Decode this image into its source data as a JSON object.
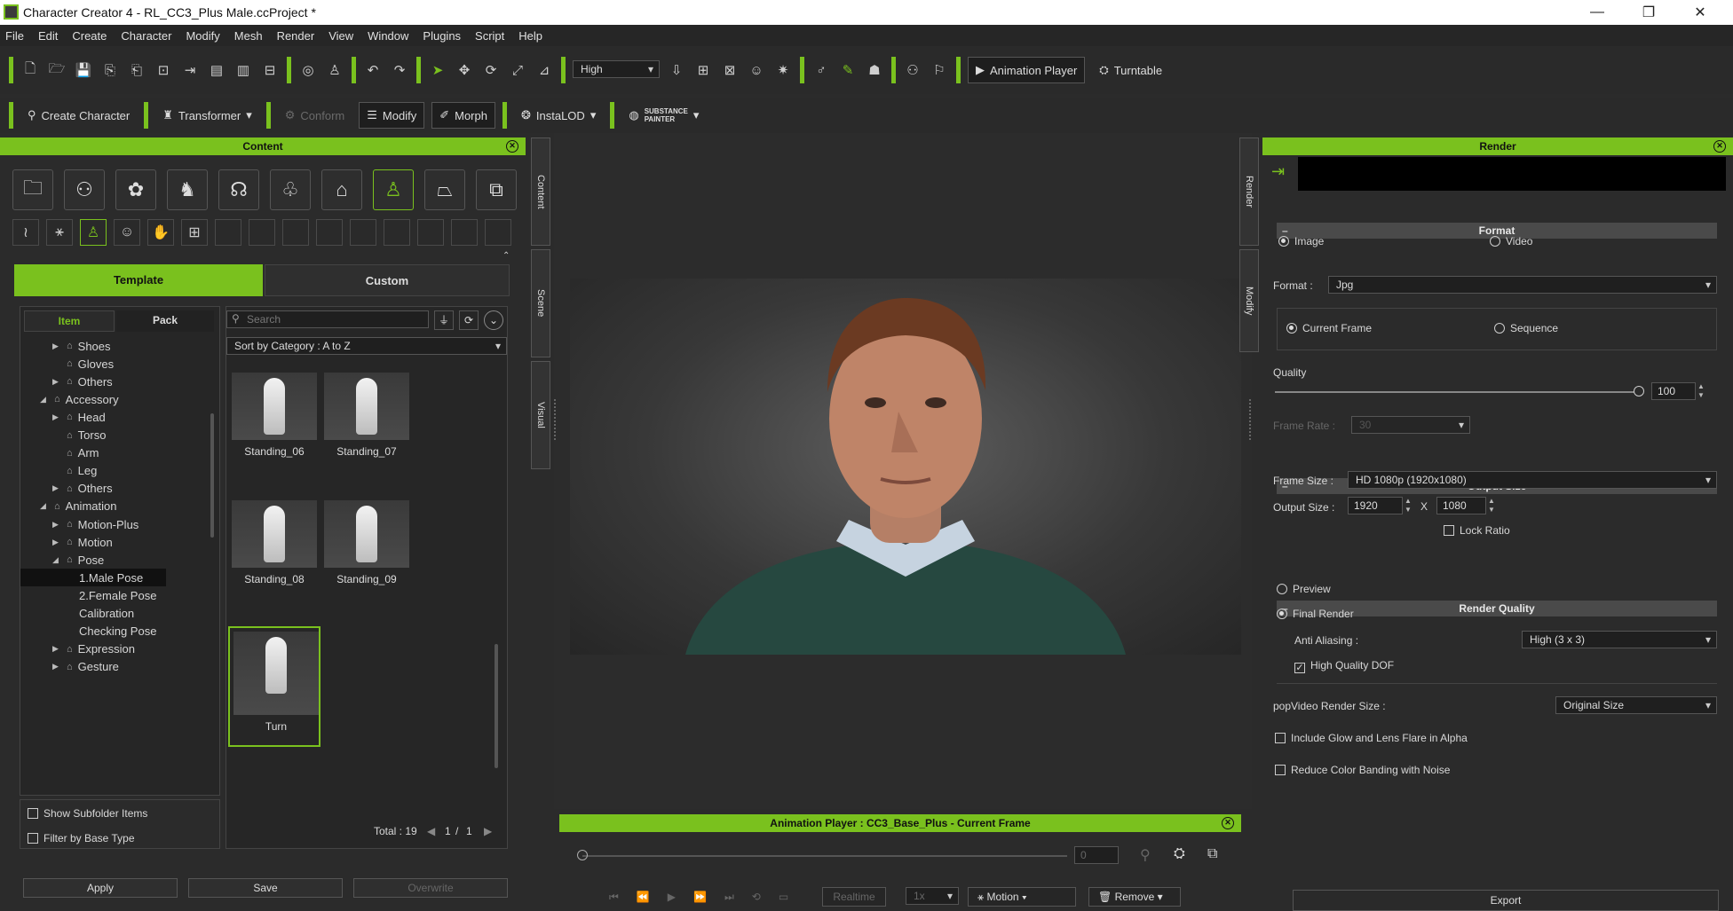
{
  "window": {
    "title": "Character Creator 4 - RL_CC3_Plus Male.ccProject *"
  },
  "menu": [
    "File",
    "Edit",
    "Create",
    "Character",
    "Modify",
    "Mesh",
    "Render",
    "View",
    "Window",
    "Plugins",
    "Script",
    "Help"
  ],
  "toolbar": {
    "quality_value": "High",
    "animation_player_label": "Animation Player",
    "turntable_label": "Turntable"
  },
  "toolbar2": {
    "create_character": "Create Character",
    "transformer": "Transformer",
    "conform": "Conform",
    "modify": "Modify",
    "morph": "Morph",
    "instalod": "InstaLOD",
    "substance_top": "SUBSTANCE",
    "substance_bottom": "PAINTER"
  },
  "content": {
    "title": "Content",
    "tabs": {
      "template": "Template",
      "custom": "Custom"
    },
    "subtabs": {
      "item": "Item",
      "pack": "Pack"
    },
    "search_placeholder": "Search",
    "sort_value": "Sort by Category : A to Z",
    "tree": [
      {
        "label": "Shoes",
        "indent": 1,
        "arrow": "▶"
      },
      {
        "label": "Gloves",
        "indent": 1,
        "arrow": ""
      },
      {
        "label": "Others",
        "indent": 1,
        "arrow": "▶"
      },
      {
        "label": "Accessory",
        "indent": 0,
        "arrow": "◢"
      },
      {
        "label": "Head",
        "indent": 1,
        "arrow": "▶"
      },
      {
        "label": "Torso",
        "indent": 1,
        "arrow": ""
      },
      {
        "label": "Arm",
        "indent": 1,
        "arrow": ""
      },
      {
        "label": "Leg",
        "indent": 1,
        "arrow": ""
      },
      {
        "label": "Others",
        "indent": 1,
        "arrow": "▶"
      },
      {
        "label": "Animation",
        "indent": 0,
        "arrow": "◢"
      },
      {
        "label": "Motion-Plus",
        "indent": 1,
        "arrow": "▶"
      },
      {
        "label": "Motion",
        "indent": 1,
        "arrow": "▶"
      },
      {
        "label": "Pose",
        "indent": 1,
        "arrow": "◢"
      },
      {
        "label": "1.Male Pose",
        "indent": 2,
        "arrow": "",
        "selected": true
      },
      {
        "label": "2.Female Pose",
        "indent": 2,
        "arrow": ""
      },
      {
        "label": "Calibration",
        "indent": 2,
        "arrow": ""
      },
      {
        "label": "Checking Pose",
        "indent": 2,
        "arrow": ""
      },
      {
        "label": "Expression",
        "indent": 1,
        "arrow": "▶"
      },
      {
        "label": "Gesture",
        "indent": 1,
        "arrow": "▶"
      }
    ],
    "thumbs": [
      {
        "label": "Standing_06"
      },
      {
        "label": "Standing_07"
      },
      {
        "label": "Standing_08"
      },
      {
        "label": "Standing_09"
      },
      {
        "label": "Turn",
        "selected": true
      }
    ],
    "show_subfolder": "Show Subfolder Items",
    "filter_base": "Filter by Base Type",
    "total_label": "Total : 19",
    "page_current": "1",
    "page_sep": "/",
    "page_total": "1",
    "apply": "Apply",
    "save": "Save",
    "overwrite": "Overwrite"
  },
  "side_tabs": {
    "content": "Content",
    "scene": "Scene",
    "visual": "Visual",
    "render": "Render",
    "modify": "Modify"
  },
  "anim_player": {
    "title": "Animation Player : CC3_Base_Plus - Current Frame",
    "frame_value": "0",
    "realtime": "Realtime",
    "speed": "1x",
    "motion": "Motion",
    "remove": "Remove"
  },
  "render": {
    "title": "Render",
    "format_section": "Format",
    "image": "Image",
    "video": "Video",
    "format_label": "Format :",
    "format_value": "Jpg",
    "current_frame": "Current Frame",
    "sequence": "Sequence",
    "quality_label": "Quality",
    "quality_value": "100",
    "quality_pct": 1.0,
    "frame_rate_label": "Frame Rate :",
    "frame_rate_value": "30",
    "output_size_section": "Output Size",
    "frame_size_label": "Frame Size :",
    "frame_size_value": "HD 1080p (1920x1080)",
    "output_size_label": "Output Size :",
    "width": "1920",
    "x": "X",
    "height": "1080",
    "lock_ratio": "Lock Ratio",
    "render_quality_section": "Render Quality",
    "preview": "Preview",
    "final_render": "Final Render",
    "anti_aliasing_label": "Anti Aliasing :",
    "anti_aliasing_value": "High (3 x 3)",
    "high_quality_dof": "High Quality DOF",
    "popvideo_label": "popVideo Render Size :",
    "popvideo_value": "Original Size",
    "include_glow": "Include Glow and Lens Flare in Alpha",
    "reduce_banding": "Reduce Color Banding with Noise",
    "export": "Export"
  },
  "colors": {
    "accent": "#7ac11e",
    "bg": "#2b2b2b"
  }
}
